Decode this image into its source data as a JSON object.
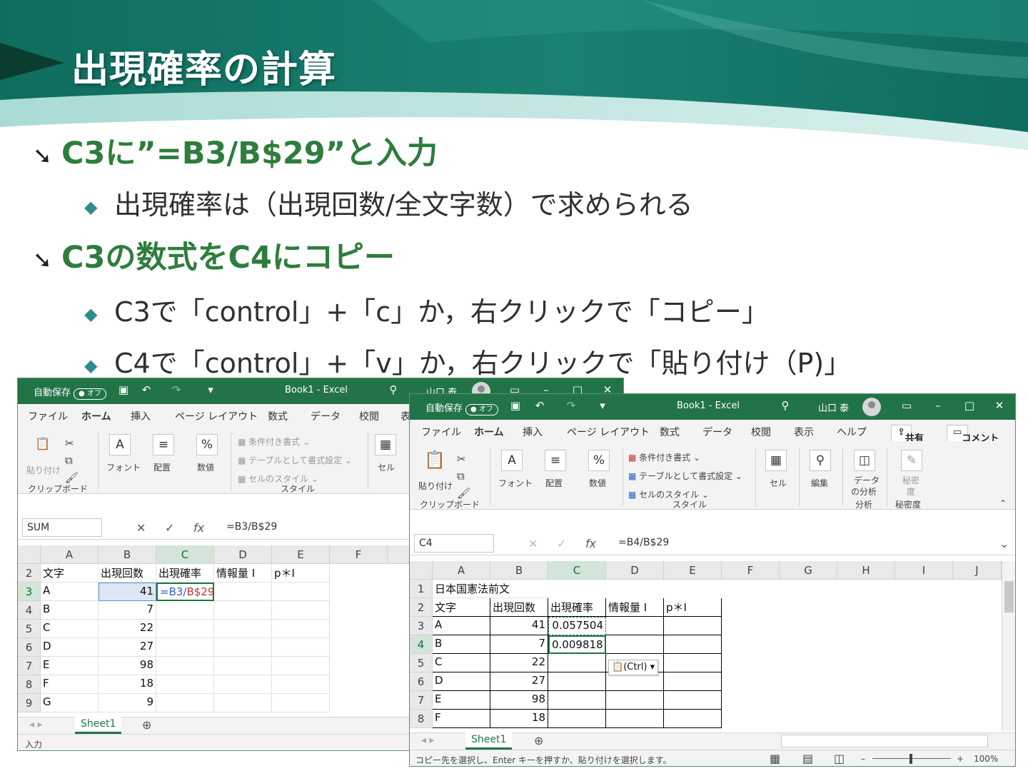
{
  "slide": {
    "title": "出現確率の計算",
    "bullets": [
      "C3に”=B3/B$29”と入力",
      "出現確率は（出現回数/全文字数）で求められる",
      "C3の数式をC4にコピー",
      "C3で「control」+「c」か，右クリックで「コピー」",
      "C4で「control」+「v」か，右クリックで「貼り付け（P)」"
    ]
  },
  "colors": {
    "excel_green": "#227447",
    "heading_green": "#2e7d3c",
    "header_teal": "#1d7f72"
  },
  "excel_left": {
    "autosave": "自動保存",
    "autosave_state": "オフ",
    "title": "Book1  -  Excel",
    "user": "山口 泰",
    "tabs": [
      "ファイル",
      "ホーム",
      "挿入",
      "ページ レイアウト",
      "数式",
      "データ",
      "校閲",
      "表"
    ],
    "ribbon": {
      "paste": "貼り付け",
      "clipboard": "クリップボード",
      "font": "フォント",
      "align": "配置",
      "number": "数値",
      "cond_format": "条件付き書式",
      "table_format": "テーブルとして書式設定",
      "cell_style": "セルのスタイル",
      "styles": "スタイル",
      "cells": "セル"
    },
    "namebox": "SUM",
    "formula": "=B3/B$29",
    "col_headers": [
      "A",
      "B",
      "C",
      "D",
      "E",
      "F"
    ],
    "row_headers": [
      "2",
      "3",
      "4",
      "5",
      "6",
      "7",
      "8",
      "9"
    ],
    "rows": [
      [
        "文字",
        "出現回数",
        "出現確率",
        "情報量 I",
        "p＊I"
      ],
      [
        "A",
        "41",
        "",
        "",
        ""
      ],
      [
        "B",
        "7",
        "",
        "",
        ""
      ],
      [
        "C",
        "22",
        "",
        "",
        ""
      ],
      [
        "D",
        "27",
        "",
        "",
        ""
      ],
      [
        "E",
        "98",
        "",
        "",
        ""
      ],
      [
        "F",
        "18",
        "",
        "",
        ""
      ],
      [
        "G",
        "9",
        "",
        "",
        ""
      ]
    ],
    "edit_formula_a": "=B3/",
    "edit_formula_b": "B$29",
    "sheet": "Sheet1",
    "status": "入力"
  },
  "excel_right": {
    "autosave": "自動保存",
    "autosave_state": "オフ",
    "title": "Book1  -  Excel",
    "user": "山口 泰",
    "tabs": [
      "ファイル",
      "ホーム",
      "挿入",
      "ページ レイアウト",
      "数式",
      "データ",
      "校閲",
      "表示",
      "ヘルプ"
    ],
    "share": "共有",
    "comment": "コメント",
    "ribbon": {
      "paste": "貼り付け",
      "clipboard": "クリップボード",
      "font": "フォント",
      "align": "配置",
      "number": "数値",
      "cond_format": "条件付き書式",
      "table_format": "テーブルとして書式設定",
      "cell_style": "セルのスタイル",
      "styles": "スタイル",
      "cells": "セル",
      "edit": "編集",
      "data_analysis_1": "データ",
      "data_analysis_2": "の分析",
      "analysis": "分析",
      "sensitivity_1": "秘密",
      "sensitivity_2": "度",
      "sensitivity": "秘密度"
    },
    "namebox": "C4",
    "formula": "=B4/B$29",
    "col_headers": [
      "A",
      "B",
      "C",
      "D",
      "E",
      "F",
      "G",
      "H",
      "I",
      "J"
    ],
    "row_headers": [
      "1",
      "2",
      "3",
      "4",
      "5",
      "6",
      "7",
      "8"
    ],
    "title_cell": "日本国憲法前文",
    "rows": [
      [
        "文字",
        "出現回数",
        "出現確率",
        "情報量 I",
        "p＊I"
      ],
      [
        "A",
        "41",
        "0.057504",
        "",
        ""
      ],
      [
        "B",
        "7",
        "0.009818",
        "",
        ""
      ],
      [
        "C",
        "22",
        "",
        "",
        ""
      ],
      [
        "D",
        "27",
        "",
        "",
        ""
      ],
      [
        "E",
        "98",
        "",
        "",
        ""
      ],
      [
        "F",
        "18",
        "",
        "",
        ""
      ]
    ],
    "paste_options": "(Ctrl)",
    "sheet": "Sheet1",
    "status": "コピー先を選択し、Enter キーを押すか、貼り付けを選択します。",
    "zoom": "100%"
  }
}
